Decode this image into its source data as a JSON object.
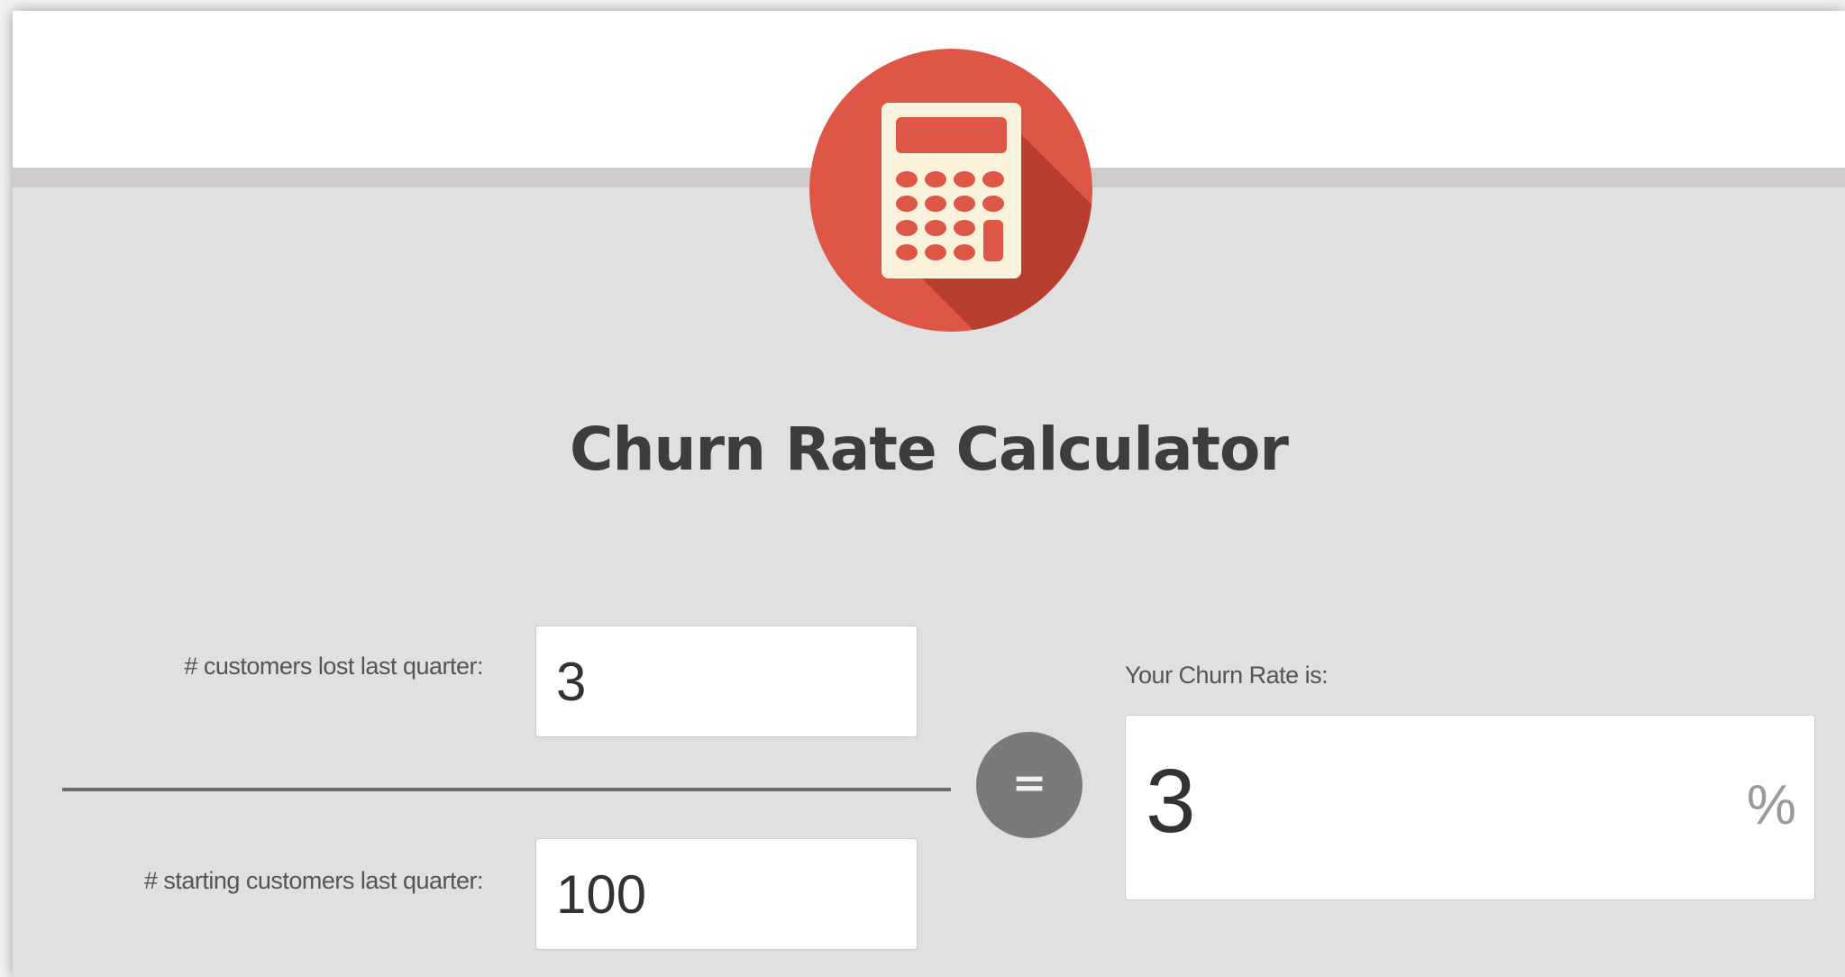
{
  "header": {
    "icon": "calculator-icon",
    "title": "Churn Rate Calculator"
  },
  "form": {
    "lost_label": "# customers lost last quarter:",
    "lost_value": "3",
    "start_label": "# starting customers last quarter:",
    "start_value": "100",
    "equals_symbol": "="
  },
  "result": {
    "label": "Your Churn Rate is:",
    "value": "3",
    "unit": "%"
  },
  "colors": {
    "icon_circle": "#de5646",
    "icon_shadow": "#b83e2f",
    "calculator_body": "#fbf2dc",
    "background": "#e0e0e0",
    "title_text": "#3d3d3d"
  }
}
